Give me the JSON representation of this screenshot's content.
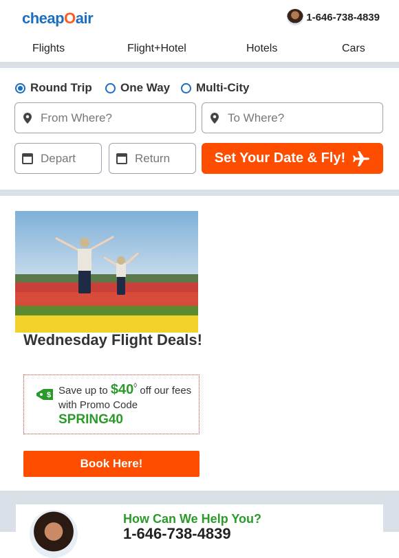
{
  "header": {
    "logo_text_a": "cheap",
    "logo_text_o": "O",
    "logo_text_b": "air",
    "phone": "1-646-738-4839"
  },
  "nav": {
    "items": [
      "Flights",
      "Flight+Hotel",
      "Hotels",
      "Cars"
    ]
  },
  "search": {
    "trip_types": [
      "Round Trip",
      "One Way",
      "Multi-City"
    ],
    "selected_trip": "Round Trip",
    "from_placeholder": "From Where?",
    "to_placeholder": "To Where?",
    "depart_placeholder": "Depart",
    "return_placeholder": "Return",
    "cta_label": "Set Your Date & Fly!"
  },
  "deal": {
    "title": "Wednesday Flight Deals!",
    "save_prefix": "Save up to",
    "save_amount": "$40",
    "save_marker": "◊",
    "save_suffix": "off our fees",
    "promo_prefix": "with Promo Code",
    "promo_code": "SPRING40",
    "book_label": "Book Here!"
  },
  "help": {
    "title": "How Can We Help You?",
    "phone": "1-646-738-4839"
  },
  "colors": {
    "brand_blue": "#1b6ec2",
    "accent_orange": "#ff4d00",
    "promo_green": "#2b9a2b",
    "band_gray": "#d9e0e8"
  }
}
